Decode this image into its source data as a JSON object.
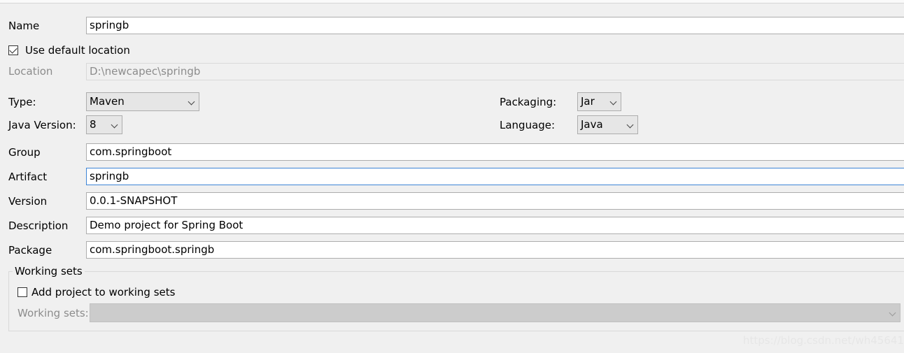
{
  "project": {
    "name_label": "Name",
    "name_value": "springb",
    "use_default_location_label": "Use default location",
    "use_default_location_checked": true,
    "location_label": "Location",
    "location_value": "D:\\newcapec\\springb"
  },
  "options": {
    "type_label": "Type:",
    "type_value": "Maven",
    "packaging_label": "Packaging:",
    "packaging_value": "Jar",
    "java_version_label": "Java Version:",
    "java_version_value": "8",
    "language_label": "Language:",
    "language_value": "Java"
  },
  "coordinates": {
    "group_label": "Group",
    "group_value": "com.springboot",
    "artifact_label": "Artifact",
    "artifact_value": "springb",
    "version_label": "Version",
    "version_value": "0.0.1-SNAPSHOT",
    "description_label": "Description",
    "description_value": "Demo project for Spring Boot",
    "package_label": "Package",
    "package_value": "com.springboot.springb"
  },
  "working_sets": {
    "title": "Working sets",
    "add_label": "Add project to working sets",
    "add_checked": false,
    "sets_label": "Working sets:"
  },
  "watermark": "https://blog.csdn.net/wh456413"
}
